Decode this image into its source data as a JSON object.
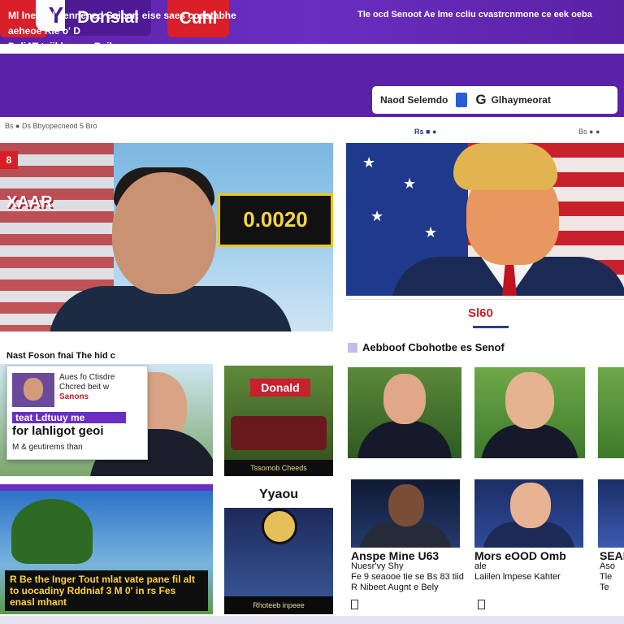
{
  "top_nav": {
    "logo_glyph": "Y",
    "tab_active": "Donslal",
    "tab_red": "Cuhl",
    "colors": {
      "bar": "#5b22a8",
      "accent_red": "#d91f2a"
    }
  },
  "banner": {
    "left_lines": [
      "Ml lne ccd sennened Saipar: eise saes coastabhe",
      "aeheoe Rle o' D",
      "DeliAT taiil kay on Reile ps."
    ],
    "right_text": "Tle ocd Senoot Ae lme ccliu cvastrcnmone ce eek oeba",
    "search": {
      "left_text": "Naod Selemdo",
      "right_text": "Glhaymeorat",
      "g_glyph": "G"
    }
  },
  "subnav": {
    "left": "Bs ● Ds Bbyopecneod 5 Bro",
    "center": "Rs ■ ●",
    "right": "Bs ● ●"
  },
  "hero_left": {
    "tag": "8",
    "title": "XAAR",
    "counter": "0.0020"
  },
  "hero_right": {
    "caption": "Sl60"
  },
  "section_left": "Nast Foson fnai The hid c",
  "section_right": "Aebboof Cbohotbe es Senof",
  "popup": {
    "line1": "Aues fo Ctisdre",
    "line2": "Chcred beit w",
    "line3": "Sanons",
    "line4": "teat Ldtuuy me",
    "line5": "for lahligot geoi",
    "line6": "M & geutirems than"
  },
  "tiles": {
    "donald_badge": "Donald",
    "donald_caption": "Tssomob Cheeds",
    "palm_caption": "R Be the Inger Tout mlat vate pane fil alt to uocadiny Rddniaf 3 M 0' in rs Fes enasl mhant",
    "yaoo_logo": "Yyaou",
    "yaoo_caption": "Rhoteeb inpeee"
  },
  "people_cards": [
    {
      "headline": "Anspe Mine U63",
      "sub": "Nuesr'vy Shy",
      "body": "Fe 9 seaooe tie se Bs 83 tiid",
      "foot": "R Nibeet Augnt e Bely"
    },
    {
      "headline": "Mors eOOD Omb",
      "sub": "ale",
      "body": "",
      "foot": "Laiilen lmpese Kahter"
    },
    {
      "headline": "SEAI",
      "sub": "Aso",
      "body": "Tle",
      "foot": "Te"
    }
  ]
}
